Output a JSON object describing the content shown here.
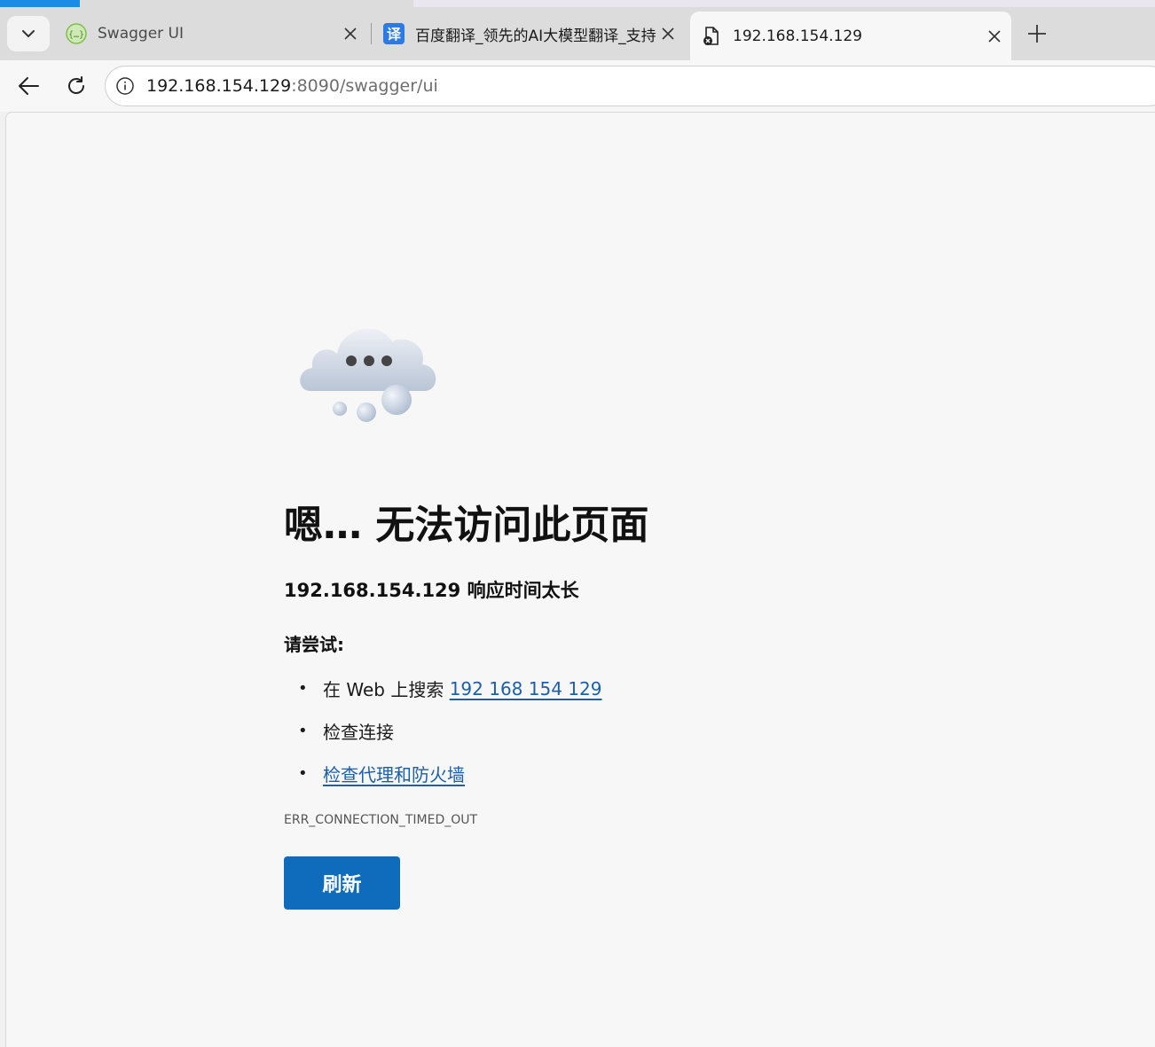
{
  "tabs": [
    {
      "title": "Swagger UI",
      "icon": "swagger-icon"
    },
    {
      "title": "百度翻译_领先的AI大模型翻译_支持",
      "icon": "baidu-translate-icon",
      "icon_glyph": "译"
    },
    {
      "title": "192.168.154.129",
      "icon": "error-page-icon",
      "active": true
    }
  ],
  "address_bar": {
    "host": "192.168.154.129",
    "rest": ":8090/swagger/ui"
  },
  "error_page": {
    "heading": "嗯… 无法访问此页面",
    "subheading": "192.168.154.129 响应时间太长",
    "try_label": "请尝试:",
    "suggestions": {
      "search_prefix": "在 Web 上搜索 ",
      "search_link": "192 168 154 129",
      "check_connection": "检查连接",
      "check_proxy": "检查代理和防火墙"
    },
    "error_code": "ERR_CONNECTION_TIMED_OUT",
    "refresh_label": "刷新",
    "bullet": "•"
  },
  "colors": {
    "accent": "#0f6cbd",
    "link": "#1b5fa8"
  }
}
